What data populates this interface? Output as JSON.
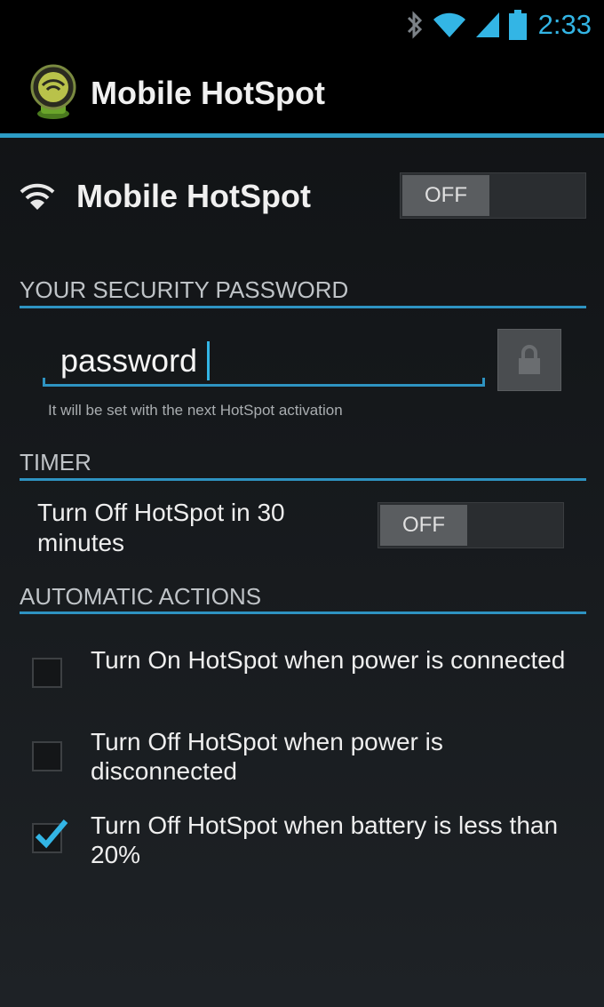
{
  "status_bar": {
    "time": "2:33",
    "icons": [
      "bluetooth-icon",
      "wifi-signal-icon",
      "cell-signal-icon",
      "battery-icon"
    ]
  },
  "action_bar": {
    "title": "Mobile HotSpot",
    "icon": "hotspot-app-icon"
  },
  "hotspot": {
    "label": "Mobile HotSpot",
    "icon": "wifi-icon",
    "toggle": "OFF"
  },
  "security": {
    "header": "YOUR SECURITY PASSWORD",
    "password_value": "password",
    "lock_icon": "lock-icon",
    "hint": "It will be set with the next HotSpot activation"
  },
  "timer": {
    "header": "TIMER",
    "label": "Turn Off HotSpot in 30 minutes",
    "toggle": "OFF"
  },
  "automatic_actions": {
    "header": "AUTOMATIC ACTIONS",
    "items": [
      {
        "label": "Turn On HotSpot when power is connected",
        "checked": false
      },
      {
        "label": "Turn Off HotSpot when power is disconnected",
        "checked": false
      },
      {
        "label": "Turn Off HotSpot when battery is less than 20%",
        "checked": true
      }
    ]
  },
  "colors": {
    "accent": "#33b5e5",
    "background": "#15181b"
  }
}
